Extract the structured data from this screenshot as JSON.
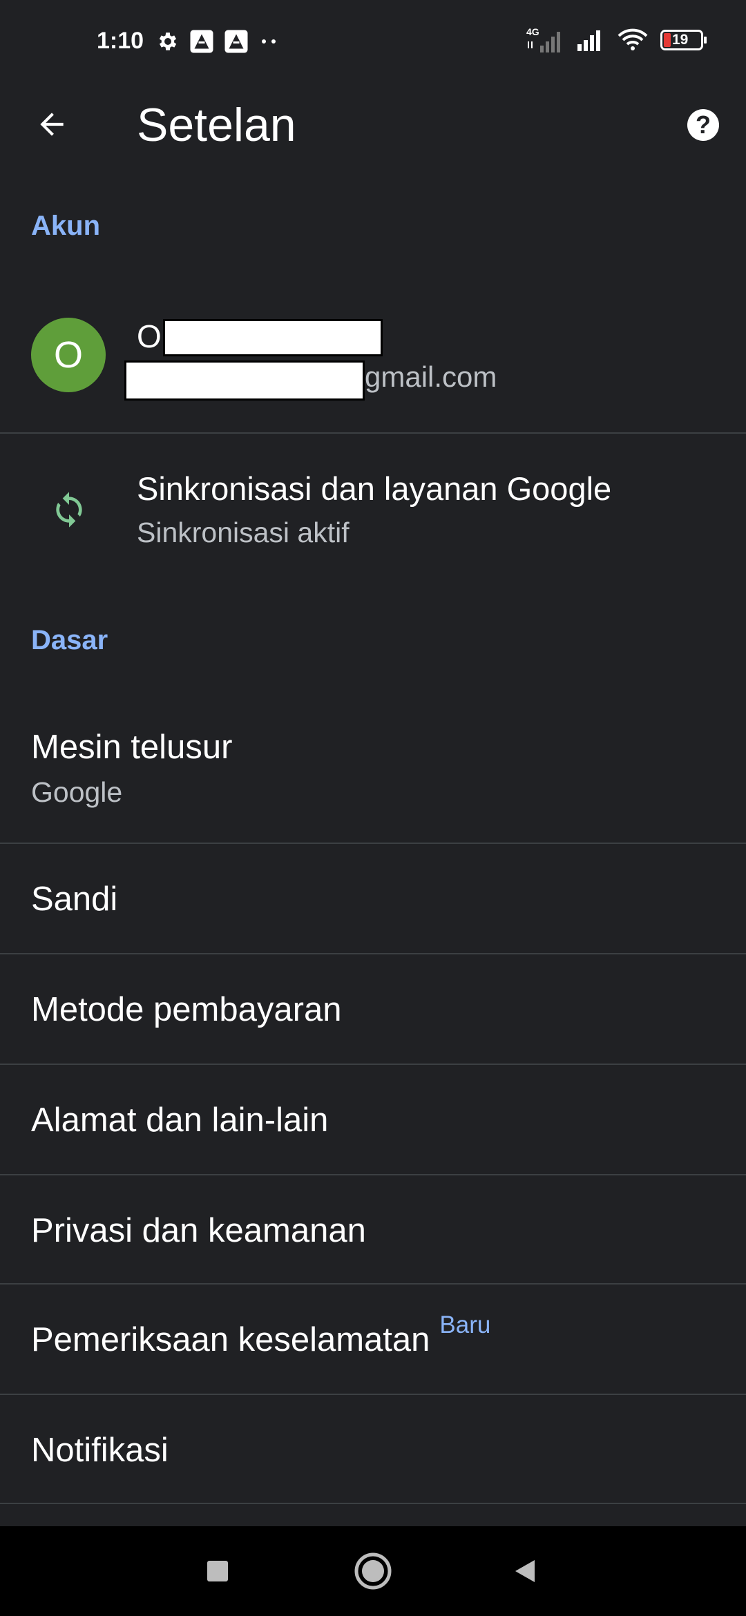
{
  "status_bar": {
    "time": "1:10",
    "network_type": "4G",
    "battery_level": "19",
    "icons_left": [
      "gear-icon",
      "notification-app-icon",
      "notification-app-icon",
      "more-dots-icon"
    ],
    "icons_right": [
      "signal-4g-icon",
      "signal-icon",
      "wifi-icon",
      "battery-icon"
    ]
  },
  "app_bar": {
    "title": "Setelan",
    "back_icon": "arrow-back-icon",
    "help_icon": "help-icon",
    "help_glyph": "?"
  },
  "sections": {
    "account": "Akun",
    "basic": "Dasar"
  },
  "account": {
    "avatar_letter": "O",
    "name_visible": "O",
    "email_visible": "gmail.com"
  },
  "sync": {
    "title": "Sinkronisasi dan layanan Google",
    "subtitle": "Sinkronisasi aktif",
    "icon": "sync-icon",
    "icon_color": "#81c995"
  },
  "basic_items": [
    {
      "title": "Mesin telusur",
      "subtitle": "Google"
    },
    {
      "title": "Sandi"
    },
    {
      "title": "Metode pembayaran"
    },
    {
      "title": "Alamat dan lain-lain"
    },
    {
      "title": "Privasi dan keamanan"
    },
    {
      "title": "Pemeriksaan keselamatan",
      "badge": "Baru"
    },
    {
      "title": "Notifikasi"
    }
  ],
  "colors": {
    "background": "#202124",
    "accent": "#8ab4f8",
    "avatar": "#5f9e3a",
    "divider": "#3c4043"
  },
  "nav_bar": {
    "buttons": [
      "recents-square-icon",
      "home-circle-icon",
      "back-triangle-icon"
    ]
  }
}
